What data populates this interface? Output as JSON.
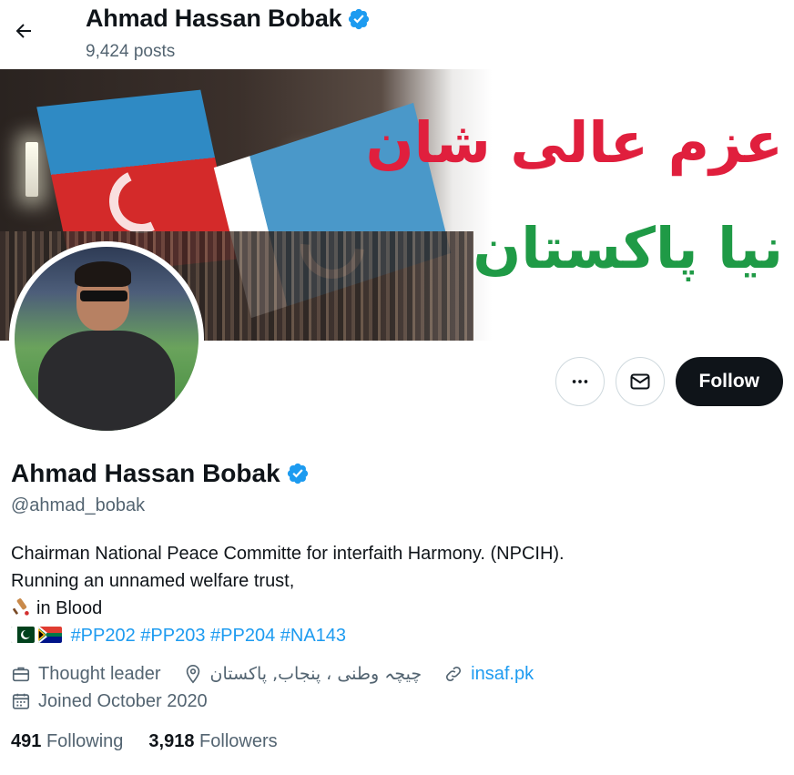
{
  "header": {
    "name": "Ahmad Hassan Bobak",
    "posts_count": "9,424 posts"
  },
  "banner": {
    "urdu_line1": "عزم عالی شان",
    "urdu_line2": "نیا پاکستان"
  },
  "actions": {
    "follow_label": "Follow"
  },
  "profile": {
    "name": "Ahmad Hassan Bobak",
    "handle": "@ahmad_bobak",
    "bio_line1": "Chairman National Peace Committe for interfaith Harmony. (NPCIH).",
    "bio_line2": "Running an unnamed welfare trust,",
    "bio_line3": "in Blood",
    "hashtags": [
      "#PP202",
      "#PP203",
      "#PP204",
      "#NA143"
    ],
    "category": "Thought leader",
    "location": "چیچہ وطنی ، پنجاب, پاکستان",
    "website": "insaf.pk",
    "joined": "Joined October 2020",
    "following_count": "491",
    "following_label": "Following",
    "followers_count": "3,918",
    "followers_label": "Followers"
  },
  "colors": {
    "accent": "#1d9bf0",
    "verified": "#1d9bf0",
    "text_secondary": "#536471"
  }
}
